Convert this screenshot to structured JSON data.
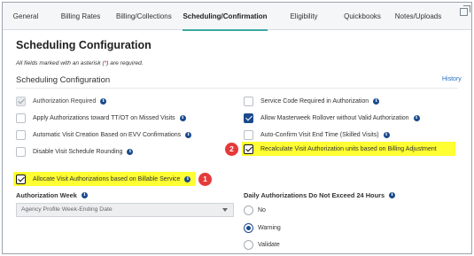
{
  "tabs": [
    {
      "label": "General",
      "active": false
    },
    {
      "label": "Billing Rates",
      "active": false
    },
    {
      "label": "Billing/Collections",
      "active": false
    },
    {
      "label": "Scheduling/Confirmation",
      "active": true
    },
    {
      "label": "Eligibility",
      "active": false
    },
    {
      "label": "Quickbooks",
      "active": false
    },
    {
      "label": "Notes/Uploads",
      "active": false
    }
  ],
  "page": {
    "title": "Scheduling Configuration",
    "required_note_prefix": "All fields marked with an asterisk (",
    "required_note_star": "*",
    "required_note_suffix": ") are required.",
    "subtitle": "Scheduling Configuration",
    "history_link": "History"
  },
  "left_options": [
    {
      "label": "Authorization Required",
      "checked": true,
      "disabled": true
    },
    {
      "label": "Apply Authorizations toward TT/OT on Missed Visits",
      "checked": false
    },
    {
      "label": "Automatic Visit Creation Based on EVV Confirmations",
      "checked": false
    },
    {
      "label": "Disable Visit Schedule Rounding",
      "checked": false
    },
    {
      "label": "Allocate Visit Authorizations based on Billable Service",
      "checked": true,
      "highlighted": true
    }
  ],
  "right_options": [
    {
      "label": "Service Code Required in Authorization",
      "checked": false
    },
    {
      "label": "Allow Masterweek Rollover without Valid Authorization",
      "checked": true
    },
    {
      "label": "Auto-Confirm Visit End Time (Skilled Visits)",
      "checked": false
    },
    {
      "label": "Recalculate Visit Authorization units based on Billing Adjustment",
      "checked": true,
      "highlighted": true
    }
  ],
  "callouts": {
    "one": "1",
    "two": "2"
  },
  "authorization_week": {
    "label": "Authorization Week",
    "selected": "Agency Profile Week-Ending Date"
  },
  "daily_authorizations": {
    "label": "Daily Authorizations Do Not Exceed 24 Hours",
    "options": [
      {
        "label": "No",
        "selected": false
      },
      {
        "label": "Warning",
        "selected": true
      },
      {
        "label": "Validate",
        "selected": false
      }
    ]
  },
  "colors": {
    "accent_tab_underline": "#3ba7a2",
    "checkbox_blue": "#1a4a8c",
    "highlight_yellow": "#ffff33",
    "callout_red": "#e63939",
    "link_blue": "#1f6fbf"
  }
}
